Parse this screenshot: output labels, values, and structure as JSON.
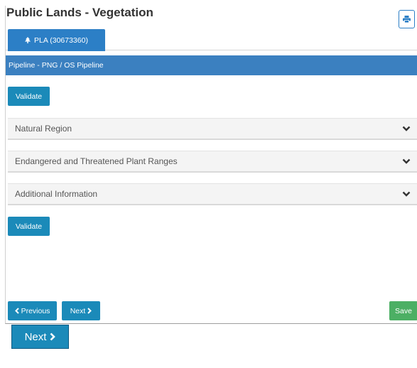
{
  "page": {
    "title": "Public Lands - Vegetation"
  },
  "toolbar": {
    "print_icon": "print-icon"
  },
  "tabs": [
    {
      "label": "PLA (30673360)",
      "icon": "tree-icon",
      "active": true
    }
  ],
  "section": {
    "header": "Pipeline - PNG / OS Pipeline"
  },
  "actions": {
    "validate_top": "Validate",
    "validate_bottom": "Validate",
    "previous": "Previous",
    "next": "Next",
    "save": "Save",
    "next_large": "Next"
  },
  "accordions": [
    {
      "label": "Natural Region",
      "expanded": false
    },
    {
      "label": "Endangered and Threatened Plant Ranges",
      "expanded": false
    },
    {
      "label": "Additional Information",
      "expanded": false
    }
  ],
  "colors": {
    "primary": "#2c7fc6",
    "header_bar": "#3b80c0",
    "button": "#1b8ab9",
    "save": "#4caf64",
    "accordion_bg": "#f4f4f4"
  }
}
